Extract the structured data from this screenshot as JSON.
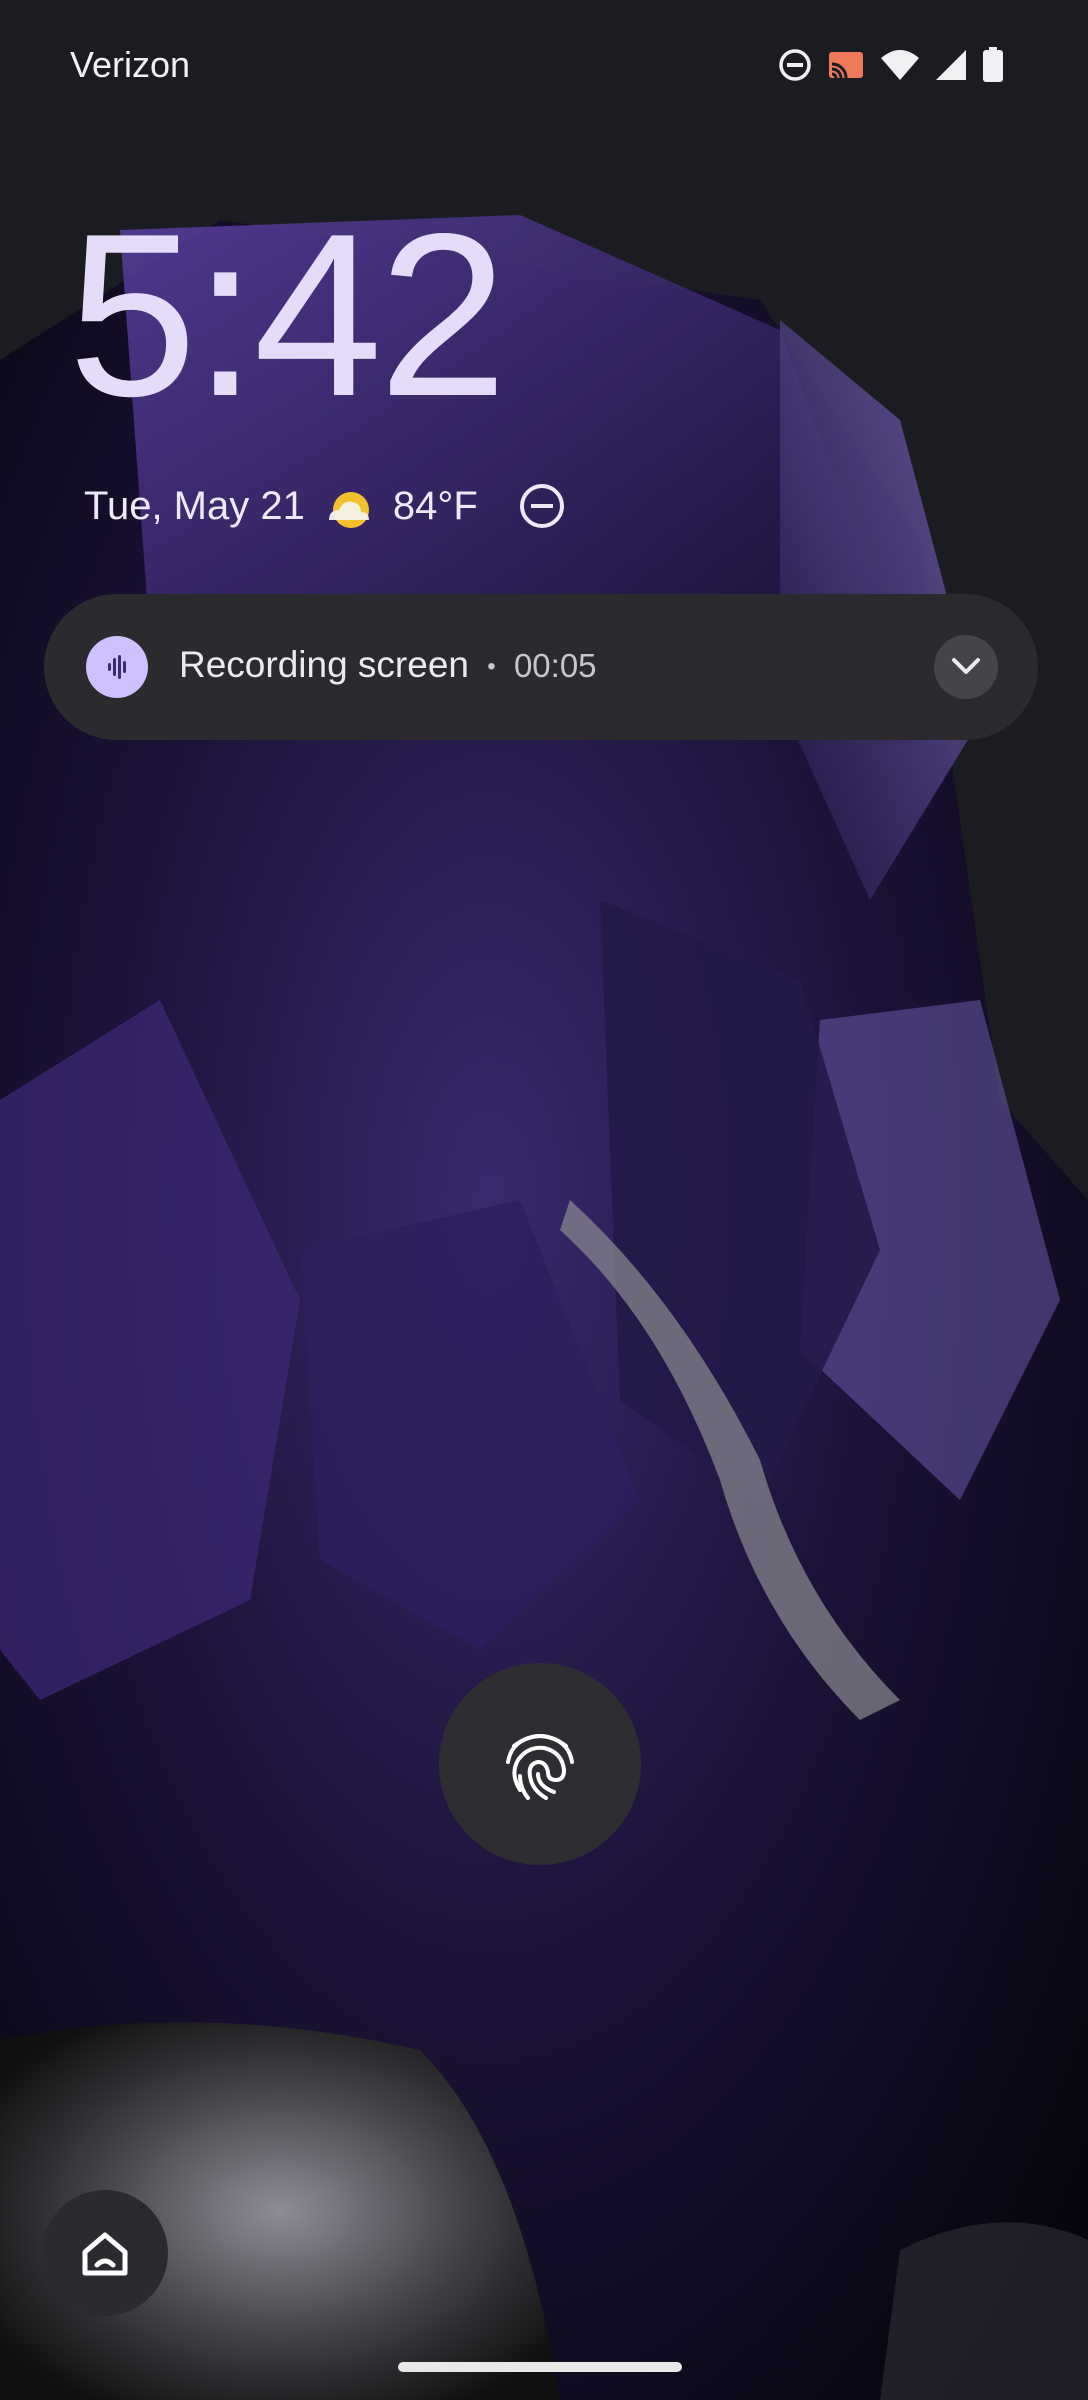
{
  "status_bar": {
    "carrier": "Verizon",
    "icons": [
      "do-not-disturb-icon",
      "cast-icon",
      "wifi-icon",
      "cell-signal-icon",
      "battery-icon"
    ]
  },
  "lockscreen": {
    "time": "5:42",
    "date": "Tue, May 21",
    "weather_icon": "partly-sunny-icon",
    "temperature": "84°F",
    "dnd_icon": "do-not-disturb-icon"
  },
  "notification": {
    "app_icon": "sound-wave-icon",
    "title": "Recording screen",
    "separator": "•",
    "elapsed": "00:05",
    "expand_icon": "chevron-down-icon"
  },
  "controls": {
    "fingerprint_icon": "fingerprint-icon",
    "home_icon": "home-icon"
  },
  "colors": {
    "background": "#1b1c21",
    "clock": "#e4dcf8",
    "notification_bg": "#2b2a2f",
    "accent": "#cfc0ff"
  }
}
